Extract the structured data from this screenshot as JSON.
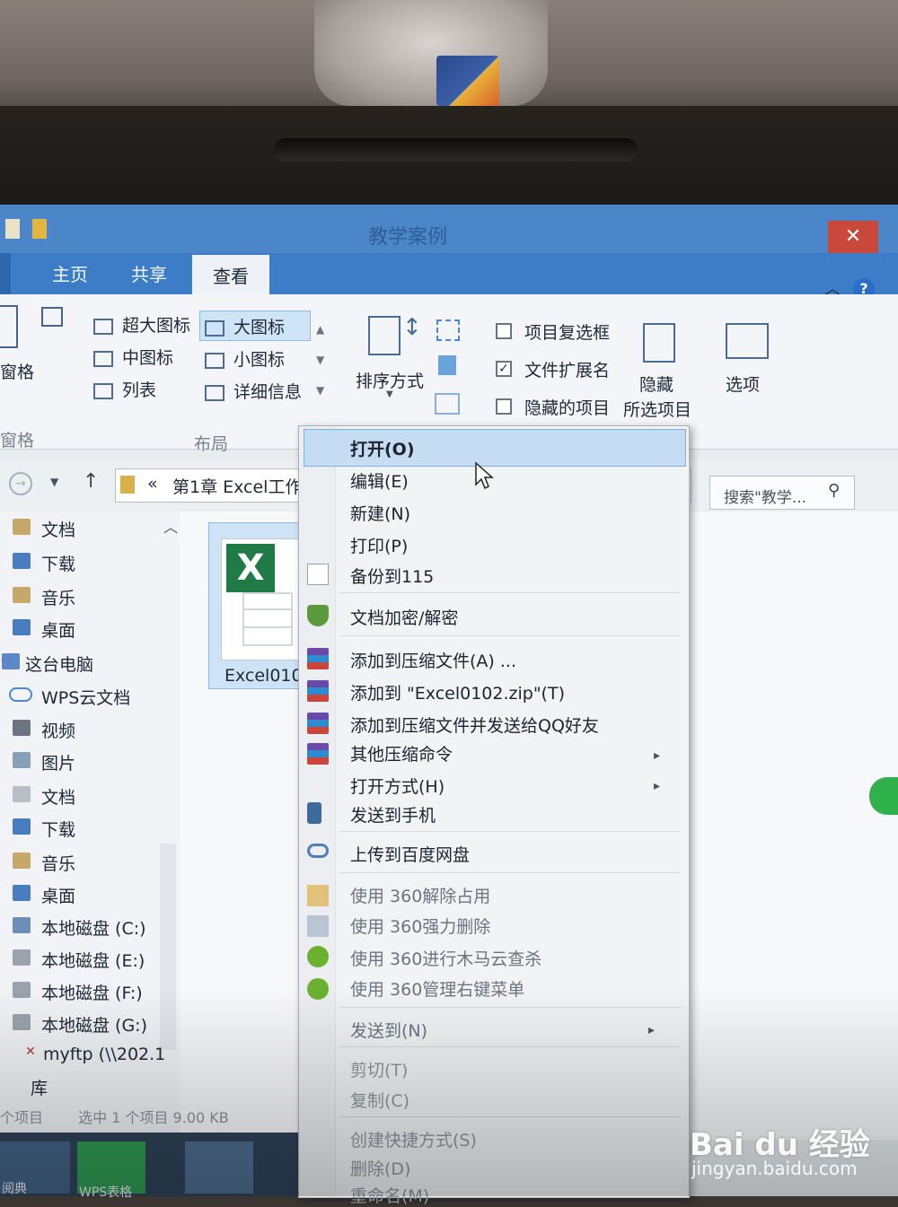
{
  "window": {
    "title": "教学案例"
  },
  "ribbon": {
    "tabs": [
      "主页",
      "共享",
      "查看"
    ],
    "active_tab": "查看",
    "left_group": {
      "label": "窗格",
      "footer": "窗格"
    },
    "layout": {
      "items": [
        "超大图标",
        "大图标",
        "中图标",
        "小图标",
        "列表",
        "详细信息"
      ],
      "selected": "大图标",
      "footer": "布局"
    },
    "sort": {
      "label": "排序方式"
    },
    "show_hide": {
      "item_checkboxes": {
        "label": "项目复选框",
        "checked": false
      },
      "file_extensions": {
        "label": "文件扩展名",
        "checked": true
      },
      "hidden_items": {
        "label": "隐藏的项目",
        "checked": false
      },
      "hide_selected_1": "隐藏",
      "hide_selected_2": "所选项目"
    },
    "options": {
      "label": "选项"
    },
    "help": "?"
  },
  "address": {
    "prefix": "«",
    "path": "第1章 Excel工作",
    "search_placeholder": "搜索\"教学..."
  },
  "nav": {
    "items": [
      "文档",
      "下载",
      "音乐",
      "桌面",
      "这台电脑",
      "WPS云文档",
      "视频",
      "图片",
      "文档",
      "下载",
      "音乐",
      "桌面",
      "本地磁盘 (C:)",
      "本地磁盘 (E:)",
      "本地磁盘 (F:)",
      "本地磁盘 (G:)",
      "myftp (\\\\202.1",
      "库"
    ]
  },
  "file": {
    "name": "Excel010",
    "badge": "X"
  },
  "status": {
    "count": "个项目",
    "selected": "选中 1 个项目  9.00 KB"
  },
  "taskbar": {
    "wps": "WPS表格",
    "left": "阅典"
  },
  "context_menu": {
    "items": [
      {
        "label": "打开(O)",
        "bold": true
      },
      {
        "label": "编辑(E)"
      },
      {
        "label": "新建(N)"
      },
      {
        "label": "打印(P)"
      },
      {
        "label": "备份到115"
      },
      {
        "label": "文档加密/解密"
      },
      {
        "label": "添加到压缩文件(A) ..."
      },
      {
        "label": "添加到 \"Excel0102.zip\"(T)"
      },
      {
        "label": "添加到压缩文件并发送给QQ好友"
      },
      {
        "label": "其他压缩命令"
      },
      {
        "label": "打开方式(H)"
      },
      {
        "label": "发送到手机"
      },
      {
        "label": "上传到百度网盘"
      },
      {
        "label": "使用 360解除占用"
      },
      {
        "label": "使用 360强力删除"
      },
      {
        "label": "使用 360进行木马云查杀"
      },
      {
        "label": "使用 360管理右键菜单"
      },
      {
        "label": "发送到(N)"
      },
      {
        "label": "剪切(T)"
      },
      {
        "label": "复制(C)"
      },
      {
        "label": "创建快捷方式(S)"
      },
      {
        "label": "删除(D)"
      },
      {
        "label": "重命名(M)"
      }
    ],
    "submenu_arrow": "▸"
  },
  "watermark": {
    "brand": "Bai du 经验",
    "url": "jingyan.baidu.com"
  },
  "colors": {
    "title_bar": "#4b86c8",
    "tab_row": "#3d7cc6",
    "highlight": "#c6dcf2",
    "excel_green": "#1f7a45"
  }
}
